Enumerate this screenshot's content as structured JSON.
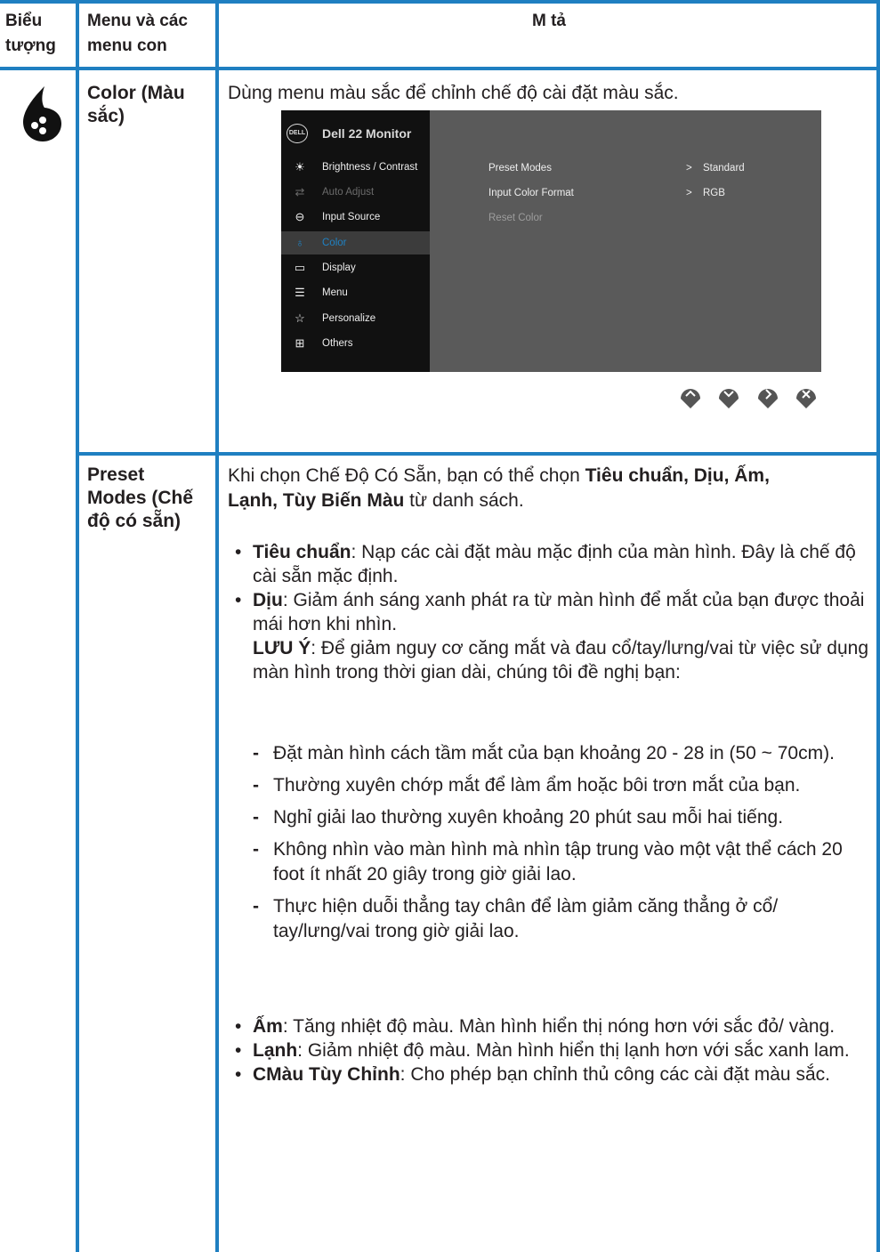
{
  "header": {
    "col1_line1": "Biểu",
    "col1_line2": "tượng",
    "col2_line1": "Menu và các",
    "col2_line2": "menu con",
    "col3": "M tả"
  },
  "colors": {
    "accent": "#1f7fc1",
    "text": "#231f20",
    "osd_bg": "#5a5a5a",
    "osd_menu_bg": "#111111",
    "osd_selected": "#1f82c4",
    "nav_button": "#555555"
  },
  "color_row": {
    "icon": "color-drop-icon",
    "menu_line1": "Color (Màu",
    "menu_line2": "sắc)",
    "description": "Dùng menu màu sắc để chỉnh chế độ cài đặt màu sắc."
  },
  "osd": {
    "logo": "DELL",
    "title": "Dell 22 Monitor",
    "menu": [
      {
        "icon": "brightness-icon",
        "glyph": "☀",
        "label": "Brightness / Contrast",
        "state": "normal"
      },
      {
        "icon": "auto-adjust-icon",
        "glyph": "⇄",
        "label": "Auto Adjust",
        "state": "disabled"
      },
      {
        "icon": "input-source-icon",
        "glyph": "⊖",
        "label": "Input Source",
        "state": "normal"
      },
      {
        "icon": "color-icon",
        "glyph": "♁",
        "label": "Color",
        "state": "selected"
      },
      {
        "icon": "display-icon",
        "glyph": "▭",
        "label": "Display",
        "state": "normal"
      },
      {
        "icon": "menu-icon",
        "glyph": "☰",
        "label": "Menu",
        "state": "normal"
      },
      {
        "icon": "personalize-icon",
        "glyph": "☆",
        "label": "Personalize",
        "state": "normal"
      },
      {
        "icon": "others-icon",
        "glyph": "⊞",
        "label": "Others",
        "state": "normal"
      }
    ],
    "options": [
      {
        "label": "Preset Modes",
        "arrow": ">",
        "value": "Standard"
      },
      {
        "label": "Input Color Format",
        "arrow": ">",
        "value": "RGB"
      },
      {
        "label": "Reset Color",
        "arrow": "",
        "value": ""
      }
    ],
    "buttons": [
      "up-button-icon",
      "down-button-icon",
      "right-button-icon",
      "exit-button-icon"
    ]
  },
  "preset_row": {
    "menu_line1": "Preset",
    "menu_line2": "Modes (Chế",
    "menu_line3": "độ có sẵn)",
    "intro_line1_pre": "Khi chọn Chế Độ Có Sẵn, bạn có thể chọn ",
    "intro_line1_bold": "Tiêu chuẩn, Dịu, Ấm,",
    "intro_line2_bold": "Lạnh, Tùy Biến Màu",
    "intro_line2_post": " từ danh sách.",
    "standard_term": "Tiêu chuẩn",
    "standard_desc": ": Nạp các cài đặt màu mặc định của màn hình. Đây là chế độ cài sẵn mặc định.",
    "soft_term": "Dịu",
    "soft_desc": ": Giảm ánh sáng xanh phát ra từ màn hình để mắt của bạn được thoải mái hơn khi nhìn.",
    "note_term": "LƯU Ý",
    "note_desc": ": Để giảm nguy cơ căng mắt và đau cổ/tay/lưng/vai từ việc sử dụng màn hình trong thời gian dài, chúng tôi đề nghị bạn:",
    "tips": [
      "Đặt màn hình cách tầm mắt của bạn khoảng 20 - 28 in (50 ~ 70cm).",
      "Thường xuyên chớp mắt để làm ẩm hoặc bôi trơn mắt của bạn.",
      "Nghỉ giải lao thường xuyên khoảng 20 phút sau mỗi hai tiếng.",
      "Không nhìn vào màn hình mà nhìn tập trung vào một vật thể cách 20 foot ít nhất 20 giây trong giờ giải lao.",
      "Thực hiện duỗi thẳng tay chân để làm giảm căng thẳng ở cổ/ tay/lưng/vai trong giờ giải lao."
    ],
    "warm_term": "Ấm",
    "warm_desc": ": Tăng nhiệt độ màu. Màn hình hiển thị nóng hơn với sắc đỏ/ vàng.",
    "cool_term": "Lạnh",
    "cool_desc": ": Giảm nhiệt độ màu. Màn hình hiển thị lạnh hơn với sắc xanh lam.",
    "custom_term": "CMàu Tùy Chỉnh",
    "custom_desc": ": Cho phép bạn chỉnh thủ công các cài đặt màu sắc."
  }
}
